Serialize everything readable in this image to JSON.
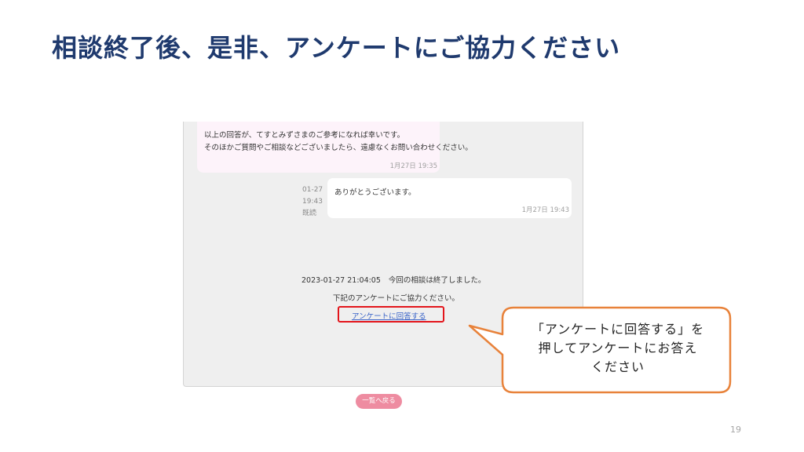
{
  "slide": {
    "title": "相談終了後、是非、アンケートにご協力ください",
    "page_number": "19"
  },
  "chat": {
    "incoming": {
      "line1": "以上の回答が、てすとみずさまのご参考になれば幸いです。",
      "line2": "そのほかご質問やご相談などございましたら、遠慮なくお問い合わせください。",
      "timestamp": "1月27日 19:35"
    },
    "meta": {
      "date": "01-27",
      "time": "19:43",
      "read_status": "既読"
    },
    "outgoing": {
      "message": "ありがとうございます。",
      "timestamp": "1月27日 19:43"
    },
    "system": {
      "datetime": "2023-01-27 21:04:05",
      "ended_text": "今回の相談は終了しました。",
      "request_text": "下記のアンケートにご協力ください。",
      "survey_link": "アンケートに回答する"
    },
    "back_button": "一覧へ戻る"
  },
  "callout": {
    "line1": "「アンケートに回答する」を",
    "line2": "押してアンケートにお答え",
    "line3": "ください",
    "border_color": "#e8823a"
  },
  "colors": {
    "title": "#1f3a6e",
    "highlight": "#e3151b",
    "link": "#3a64c8",
    "back_button": "#ee8ca1"
  }
}
